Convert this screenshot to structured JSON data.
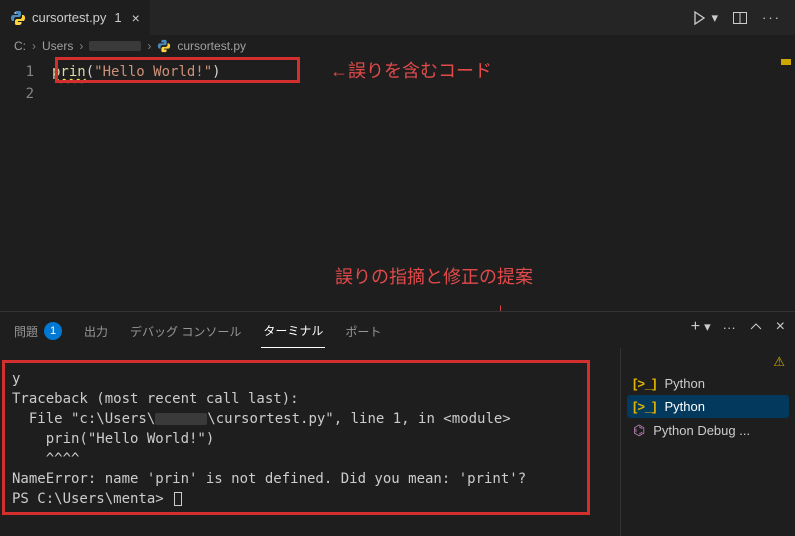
{
  "tab": {
    "filename": "cursortest.py",
    "dirty_indicator": "1",
    "close_glyph": "×"
  },
  "breadcrumb": {
    "seg0": "C:",
    "seg1": "Users",
    "seg2_redacted": true,
    "file": "cursortest.py",
    "sep": "›"
  },
  "editor": {
    "lines": [
      {
        "n": "1",
        "fn": "prin",
        "paren_open": "(",
        "str": "\"Hello World!\"",
        "paren_close": ")"
      },
      {
        "n": "2"
      }
    ]
  },
  "annotations": {
    "code_box": "←誤りを含むコード",
    "terminal_header": "誤りの指摘と修正の提案"
  },
  "panel": {
    "tabs": {
      "problems": "問題",
      "problems_badge": "1",
      "output": "出力",
      "debug_console": "デバッグ コンソール",
      "terminal": "ターミナル",
      "ports": "ポート"
    },
    "actions": {
      "new": "+",
      "more": "···",
      "maximize": "^",
      "close": "×"
    }
  },
  "terminal": {
    "pre_line": "y",
    "l1": "Traceback (most recent call last):",
    "l2a": "  File \"c:\\Users\\",
    "l2b": "\\cursortest.py\", line 1, in <module>",
    "l3": "    prin(\"Hello World!\")",
    "l4": "    ^^^^",
    "l5": "NameError: name 'prin' is not defined. Did you mean: 'print'?",
    "prompt": "PS C:\\Users\\menta> "
  },
  "terminal_sidebar": {
    "item1": "Python",
    "item2": "Python",
    "item3": "Python Debug ..."
  },
  "colors": {
    "annotation_red": "#e24a4a",
    "highlight_box": "#d32f2f",
    "selection_blue": "#04395e"
  }
}
